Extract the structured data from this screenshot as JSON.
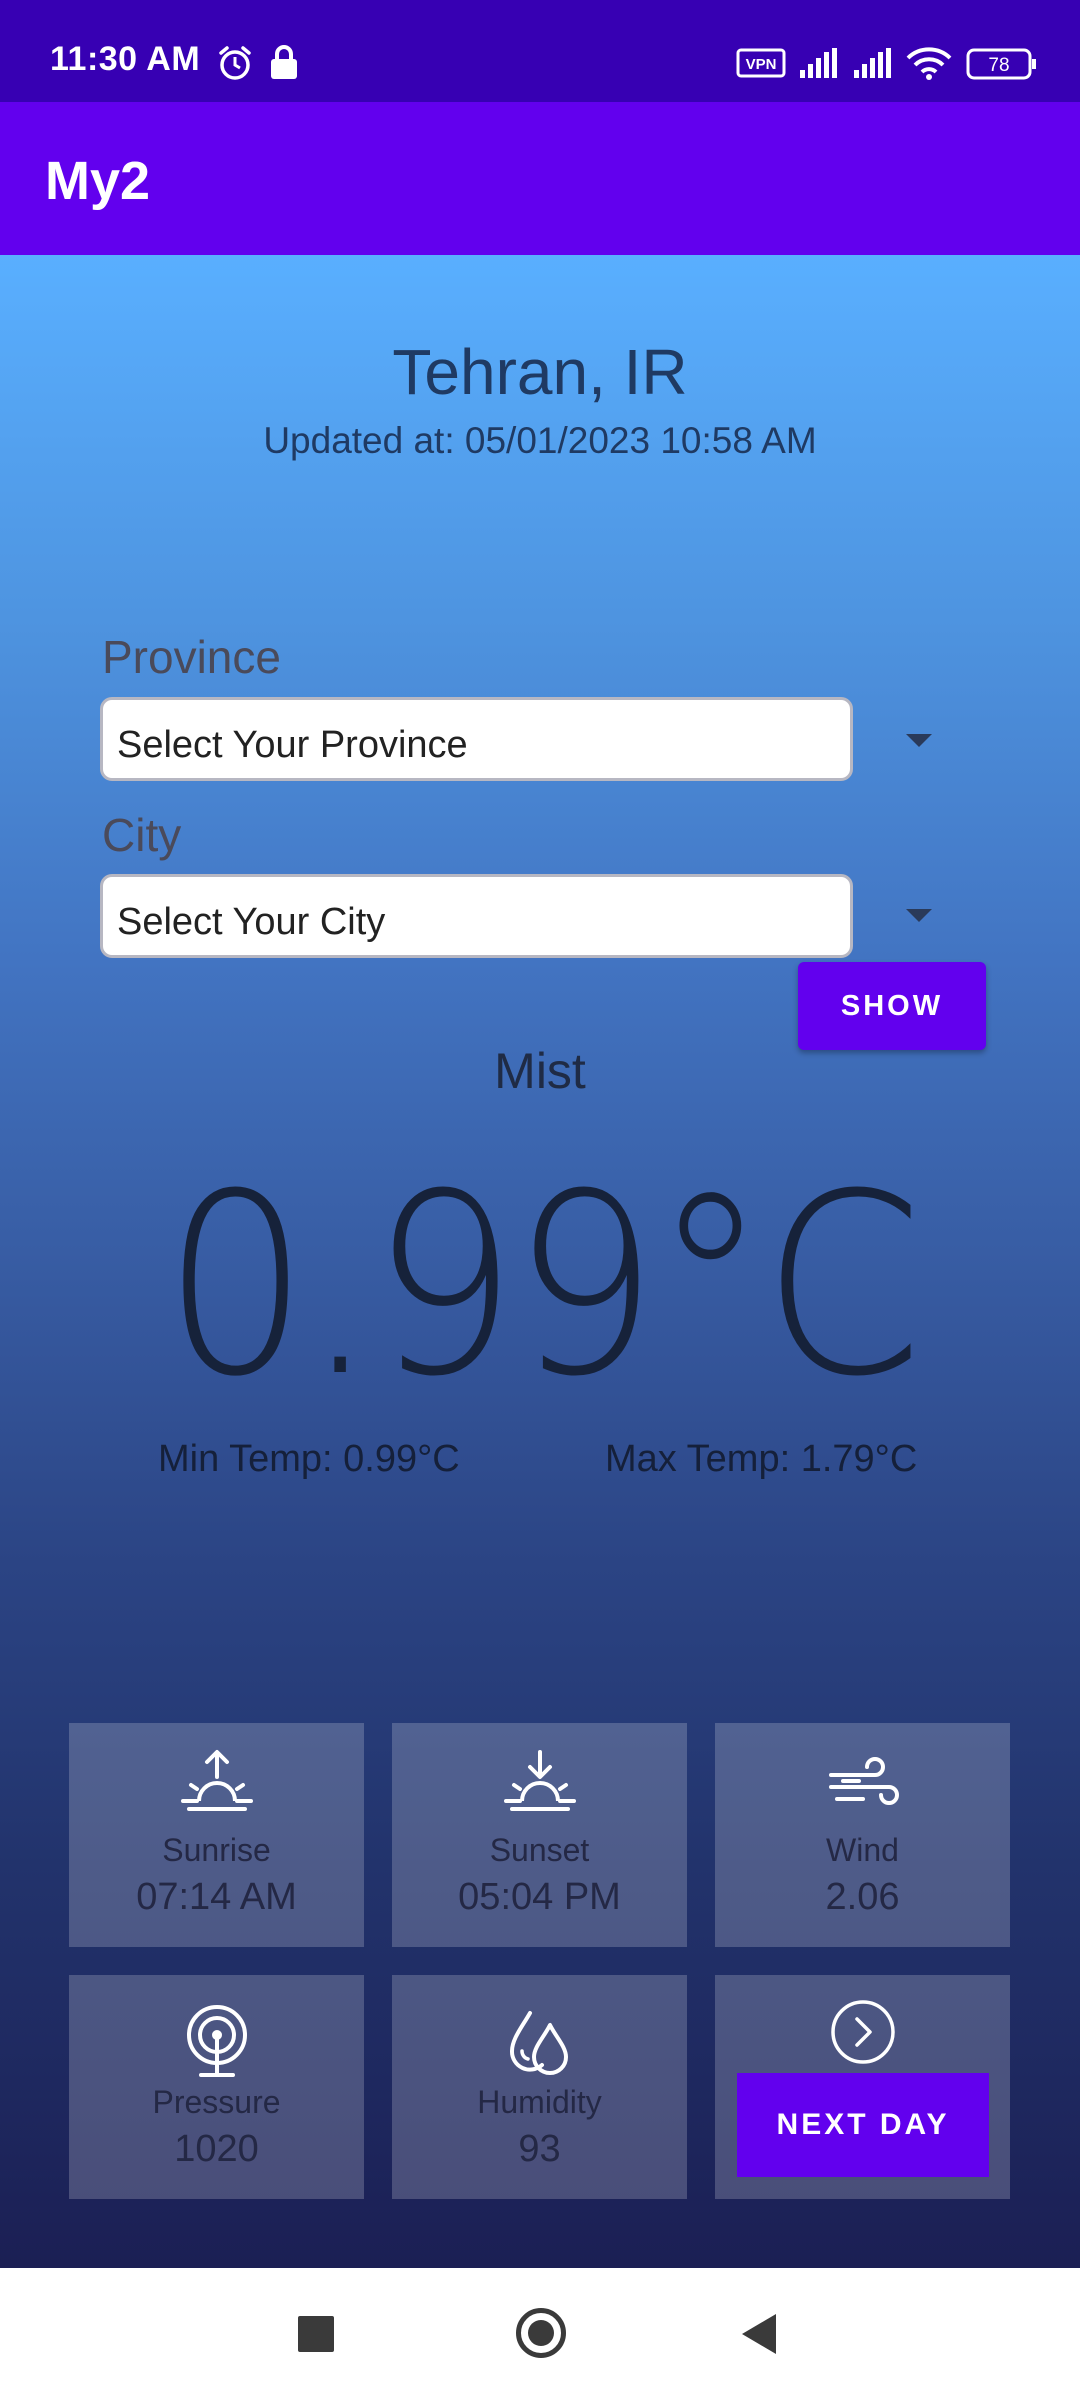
{
  "status_bar": {
    "time": "11:30 AM",
    "vpn_label": "VPN",
    "battery": "78"
  },
  "app": {
    "title": "My2"
  },
  "location": {
    "city": "Tehran, IR",
    "updated": "Updated at: 05/01/2023 10:58 AM"
  },
  "form": {
    "province_label": "Province",
    "province_placeholder": "Select Your Province",
    "city_label": "City",
    "city_placeholder": "Select Your City",
    "show_button": "SHOW"
  },
  "weather": {
    "condition": "Mist",
    "temperature": "0.99°C",
    "min_temp": "Min Temp: 0.99°C",
    "max_temp": "Max Temp: 1.79°C"
  },
  "tiles": [
    {
      "label": "Sunrise",
      "value": "07:14 AM",
      "icon": "sunrise-icon"
    },
    {
      "label": "Sunset",
      "value": "05:04 PM",
      "icon": "sunset-icon"
    },
    {
      "label": "Wind",
      "value": "2.06",
      "icon": "wind-icon"
    },
    {
      "label": "Pressure",
      "value": "1020",
      "icon": "pressure-icon"
    },
    {
      "label": "Humidity",
      "value": "93",
      "icon": "humidity-icon"
    },
    {
      "label": "",
      "value": "",
      "icon": "chevron-right-circle-icon"
    }
  ],
  "next_day_button": "NEXT DAY",
  "colors": {
    "primary": "#6200ee",
    "primary_dark": "#3700b3",
    "gradient_top": "#59afff",
    "gradient_bottom": "#1b1f54"
  }
}
